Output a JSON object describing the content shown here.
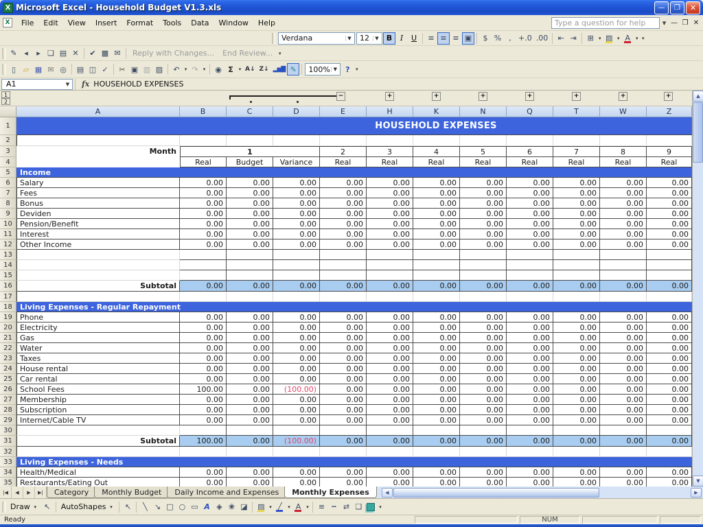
{
  "colors": {
    "banner": "#3d64dd",
    "subtotal_fill": "#a9cdf0",
    "negative": "#e0446a"
  },
  "window": {
    "title": "Microsoft Excel - Household Budget V1.3.xls"
  },
  "menu": {
    "items": [
      "File",
      "Edit",
      "View",
      "Insert",
      "Format",
      "Tools",
      "Data",
      "Window",
      "Help"
    ],
    "help_box_placeholder": "Type a question for help"
  },
  "review_toolbar": {
    "icon_groups": [
      [
        "edit-comment",
        "previous-comment",
        "next-comment",
        "show-comment",
        "show-all-comments",
        "delete-comment"
      ],
      [
        "update-file",
        "select-change",
        "send-to-mail-recipient"
      ]
    ],
    "reply_label": "Reply with Changes...",
    "end_review_label": "End Review..."
  },
  "formatting_toolbar": {
    "font_name": "Verdana",
    "font_size": "12",
    "icon_groups": [
      [
        "bold",
        "italic",
        "underline"
      ],
      [
        "align-left",
        "align-center",
        "align-right",
        "merge-and-center"
      ],
      [
        "currency",
        "percent",
        "comma",
        "increase-decimal",
        "decrease-decimal"
      ],
      [
        "decrease-indent",
        "increase-indent"
      ],
      [
        "borders",
        "fill-color",
        "font-color"
      ]
    ],
    "active": [
      "bold",
      "align-center",
      "merge-and-center"
    ]
  },
  "standard_toolbar": {
    "icon_groups": [
      [
        "new",
        "open",
        "save",
        "mail",
        "search"
      ],
      [
        "print",
        "print-preview",
        "spelling"
      ],
      [
        "cut",
        "copy",
        "paste",
        "format-painter"
      ],
      [
        "undo",
        "redo"
      ],
      [
        "insert-hyperlink",
        "autosum",
        "sort-ascending",
        "sort-descending",
        "chart-wizard",
        "drawing"
      ]
    ],
    "zoom_value": "100%",
    "help_icon": "help",
    "disabled": [
      "paste",
      "redo"
    ],
    "active": [
      "drawing"
    ]
  },
  "formula_bar": {
    "name_box": "A1",
    "formula": "HOUSEHOLD EXPENSES"
  },
  "sheet": {
    "columns": [
      "A",
      "B",
      "C",
      "D",
      "E",
      "H",
      "K",
      "N",
      "Q",
      "T",
      "W",
      "Z"
    ],
    "outline_levels": [
      "1",
      "2"
    ],
    "title": "HOUSEHOLD EXPENSES",
    "month_label": "Month",
    "month_numbers": [
      "1",
      "2",
      "3",
      "4",
      "5",
      "6",
      "7",
      "8",
      "9"
    ],
    "month1_headers": [
      "Real",
      "Budget",
      "Variance"
    ],
    "real_label": "Real",
    "body_rows": [
      {
        "n": "1",
        "t": "title"
      },
      {
        "n": "2",
        "t": "blank"
      },
      {
        "n": "3",
        "t": "month"
      },
      {
        "n": "4",
        "t": "subhdr"
      },
      {
        "n": "5",
        "t": "section",
        "label": "Income"
      },
      {
        "n": "6",
        "t": "data",
        "label": "Salary",
        "v": [
          "0.00",
          "0.00",
          "0.00",
          "0.00",
          "0.00",
          "0.00",
          "0.00",
          "0.00",
          "0.00",
          "0.00",
          "0.00"
        ]
      },
      {
        "n": "7",
        "t": "data",
        "label": "Fees",
        "v": [
          "0.00",
          "0.00",
          "0.00",
          "0.00",
          "0.00",
          "0.00",
          "0.00",
          "0.00",
          "0.00",
          "0.00",
          "0.00"
        ]
      },
      {
        "n": "8",
        "t": "data",
        "label": "Bonus",
        "v": [
          "0.00",
          "0.00",
          "0.00",
          "0.00",
          "0.00",
          "0.00",
          "0.00",
          "0.00",
          "0.00",
          "0.00",
          "0.00"
        ]
      },
      {
        "n": "9",
        "t": "data",
        "label": "Deviden",
        "v": [
          "0.00",
          "0.00",
          "0.00",
          "0.00",
          "0.00",
          "0.00",
          "0.00",
          "0.00",
          "0.00",
          "0.00",
          "0.00"
        ]
      },
      {
        "n": "10",
        "t": "data",
        "label": "Pension/Benefit",
        "v": [
          "0.00",
          "0.00",
          "0.00",
          "0.00",
          "0.00",
          "0.00",
          "0.00",
          "0.00",
          "0.00",
          "0.00",
          "0.00"
        ]
      },
      {
        "n": "11",
        "t": "data",
        "label": "Interest",
        "v": [
          "0.00",
          "0.00",
          "0.00",
          "0.00",
          "0.00",
          "0.00",
          "0.00",
          "0.00",
          "0.00",
          "0.00",
          "0.00"
        ]
      },
      {
        "n": "12",
        "t": "data",
        "label": "Other Income",
        "v": [
          "0.00",
          "0.00",
          "0.00",
          "0.00",
          "0.00",
          "0.00",
          "0.00",
          "0.00",
          "0.00",
          "0.00",
          "0.00"
        ]
      },
      {
        "n": "13",
        "t": "blankb"
      },
      {
        "n": "14",
        "t": "blankb"
      },
      {
        "n": "15",
        "t": "blankb"
      },
      {
        "n": "16",
        "t": "subtotal",
        "label": "Subtotal",
        "v": [
          "0.00",
          "0.00",
          "0.00",
          "0.00",
          "0.00",
          "0.00",
          "0.00",
          "0.00",
          "0.00",
          "0.00",
          "0.00"
        ]
      },
      {
        "n": "17",
        "t": "blank"
      },
      {
        "n": "18",
        "t": "section",
        "label": "Living Expenses - Regular Repayment"
      },
      {
        "n": "19",
        "t": "data",
        "label": "Phone",
        "v": [
          "0.00",
          "0.00",
          "0.00",
          "0.00",
          "0.00",
          "0.00",
          "0.00",
          "0.00",
          "0.00",
          "0.00",
          "0.00"
        ]
      },
      {
        "n": "20",
        "t": "data",
        "label": "Electricity",
        "v": [
          "0.00",
          "0.00",
          "0.00",
          "0.00",
          "0.00",
          "0.00",
          "0.00",
          "0.00",
          "0.00",
          "0.00",
          "0.00"
        ]
      },
      {
        "n": "21",
        "t": "data",
        "label": "Gas",
        "v": [
          "0.00",
          "0.00",
          "0.00",
          "0.00",
          "0.00",
          "0.00",
          "0.00",
          "0.00",
          "0.00",
          "0.00",
          "0.00"
        ]
      },
      {
        "n": "22",
        "t": "data",
        "label": "Water",
        "v": [
          "0.00",
          "0.00",
          "0.00",
          "0.00",
          "0.00",
          "0.00",
          "0.00",
          "0.00",
          "0.00",
          "0.00",
          "0.00"
        ]
      },
      {
        "n": "23",
        "t": "data",
        "label": "Taxes",
        "v": [
          "0.00",
          "0.00",
          "0.00",
          "0.00",
          "0.00",
          "0.00",
          "0.00",
          "0.00",
          "0.00",
          "0.00",
          "0.00"
        ]
      },
      {
        "n": "24",
        "t": "data",
        "label": "House rental",
        "v": [
          "0.00",
          "0.00",
          "0.00",
          "0.00",
          "0.00",
          "0.00",
          "0.00",
          "0.00",
          "0.00",
          "0.00",
          "0.00"
        ]
      },
      {
        "n": "25",
        "t": "data",
        "label": "Car rental",
        "v": [
          "0.00",
          "0.00",
          "0.00",
          "0.00",
          "0.00",
          "0.00",
          "0.00",
          "0.00",
          "0.00",
          "0.00",
          "0.00"
        ]
      },
      {
        "n": "26",
        "t": "data",
        "label": "School Fees",
        "v": [
          "100.00",
          "0.00",
          "(100.00)",
          "0.00",
          "0.00",
          "0.00",
          "0.00",
          "0.00",
          "0.00",
          "0.00",
          "0.00"
        ]
      },
      {
        "n": "27",
        "t": "data",
        "label": "Membership",
        "v": [
          "0.00",
          "0.00",
          "0.00",
          "0.00",
          "0.00",
          "0.00",
          "0.00",
          "0.00",
          "0.00",
          "0.00",
          "0.00"
        ]
      },
      {
        "n": "28",
        "t": "data",
        "label": "Subscription",
        "v": [
          "0.00",
          "0.00",
          "0.00",
          "0.00",
          "0.00",
          "0.00",
          "0.00",
          "0.00",
          "0.00",
          "0.00",
          "0.00"
        ]
      },
      {
        "n": "29",
        "t": "data",
        "label": "Internet/Cable TV",
        "v": [
          "0.00",
          "0.00",
          "0.00",
          "0.00",
          "0.00",
          "0.00",
          "0.00",
          "0.00",
          "0.00",
          "0.00",
          "0.00"
        ]
      },
      {
        "n": "30",
        "t": "blankb"
      },
      {
        "n": "31",
        "t": "subtotal",
        "label": "Subtotal",
        "v": [
          "100.00",
          "0.00",
          "(100.00)",
          "0.00",
          "0.00",
          "0.00",
          "0.00",
          "0.00",
          "0.00",
          "0.00",
          "0.00"
        ]
      },
      {
        "n": "32",
        "t": "blank"
      },
      {
        "n": "33",
        "t": "section",
        "label": "Living Expenses - Needs"
      },
      {
        "n": "34",
        "t": "data",
        "label": "Health/Medical",
        "v": [
          "0.00",
          "0.00",
          "0.00",
          "0.00",
          "0.00",
          "0.00",
          "0.00",
          "0.00",
          "0.00",
          "0.00",
          "0.00"
        ]
      },
      {
        "n": "35",
        "t": "data",
        "label": "Restaurants/Eating Out",
        "v": [
          "0.00",
          "0.00",
          "0.00",
          "0.00",
          "0.00",
          "0.00",
          "0.00",
          "0.00",
          "0.00",
          "0.00",
          "0.00"
        ]
      }
    ]
  },
  "tabs": {
    "sheets": [
      "Category",
      "Monthly Budget",
      "Daily Income and Expenses",
      "Monthly Expenses"
    ],
    "active": "Monthly Expenses"
  },
  "drawing_toolbar": {
    "draw_label": "Draw",
    "autoshapes_label": "AutoShapes",
    "icon_groups": [
      [
        "select-objects"
      ],
      [
        "line",
        "arrow",
        "rectangle",
        "oval",
        "text-box",
        "word-art",
        "diagram",
        "clip-art",
        "picture"
      ],
      [
        "fill-color",
        "line-color",
        "font-color"
      ],
      [
        "line-style",
        "dash-style",
        "arrow-style",
        "shadow-style",
        "3d-style"
      ]
    ]
  },
  "status_bar": {
    "mode": "Ready",
    "num_lock": "NUM"
  }
}
